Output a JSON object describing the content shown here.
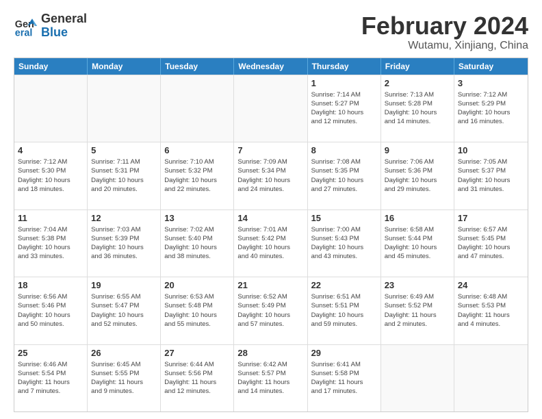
{
  "logo": {
    "text_general": "General",
    "text_blue": "Blue"
  },
  "header": {
    "title": "February 2024",
    "subtitle": "Wutamu, Xinjiang, China"
  },
  "weekdays": [
    "Sunday",
    "Monday",
    "Tuesday",
    "Wednesday",
    "Thursday",
    "Friday",
    "Saturday"
  ],
  "rows": [
    [
      {
        "day": "",
        "empty": true
      },
      {
        "day": "",
        "empty": true
      },
      {
        "day": "",
        "empty": true
      },
      {
        "day": "",
        "empty": true
      },
      {
        "day": "1",
        "info": "Sunrise: 7:14 AM\nSunset: 5:27 PM\nDaylight: 10 hours\nand 12 minutes."
      },
      {
        "day": "2",
        "info": "Sunrise: 7:13 AM\nSunset: 5:28 PM\nDaylight: 10 hours\nand 14 minutes."
      },
      {
        "day": "3",
        "info": "Sunrise: 7:12 AM\nSunset: 5:29 PM\nDaylight: 10 hours\nand 16 minutes."
      }
    ],
    [
      {
        "day": "4",
        "info": "Sunrise: 7:12 AM\nSunset: 5:30 PM\nDaylight: 10 hours\nand 18 minutes."
      },
      {
        "day": "5",
        "info": "Sunrise: 7:11 AM\nSunset: 5:31 PM\nDaylight: 10 hours\nand 20 minutes."
      },
      {
        "day": "6",
        "info": "Sunrise: 7:10 AM\nSunset: 5:32 PM\nDaylight: 10 hours\nand 22 minutes."
      },
      {
        "day": "7",
        "info": "Sunrise: 7:09 AM\nSunset: 5:34 PM\nDaylight: 10 hours\nand 24 minutes."
      },
      {
        "day": "8",
        "info": "Sunrise: 7:08 AM\nSunset: 5:35 PM\nDaylight: 10 hours\nand 27 minutes."
      },
      {
        "day": "9",
        "info": "Sunrise: 7:06 AM\nSunset: 5:36 PM\nDaylight: 10 hours\nand 29 minutes."
      },
      {
        "day": "10",
        "info": "Sunrise: 7:05 AM\nSunset: 5:37 PM\nDaylight: 10 hours\nand 31 minutes."
      }
    ],
    [
      {
        "day": "11",
        "info": "Sunrise: 7:04 AM\nSunset: 5:38 PM\nDaylight: 10 hours\nand 33 minutes."
      },
      {
        "day": "12",
        "info": "Sunrise: 7:03 AM\nSunset: 5:39 PM\nDaylight: 10 hours\nand 36 minutes."
      },
      {
        "day": "13",
        "info": "Sunrise: 7:02 AM\nSunset: 5:40 PM\nDaylight: 10 hours\nand 38 minutes."
      },
      {
        "day": "14",
        "info": "Sunrise: 7:01 AM\nSunset: 5:42 PM\nDaylight: 10 hours\nand 40 minutes."
      },
      {
        "day": "15",
        "info": "Sunrise: 7:00 AM\nSunset: 5:43 PM\nDaylight: 10 hours\nand 43 minutes."
      },
      {
        "day": "16",
        "info": "Sunrise: 6:58 AM\nSunset: 5:44 PM\nDaylight: 10 hours\nand 45 minutes."
      },
      {
        "day": "17",
        "info": "Sunrise: 6:57 AM\nSunset: 5:45 PM\nDaylight: 10 hours\nand 47 minutes."
      }
    ],
    [
      {
        "day": "18",
        "info": "Sunrise: 6:56 AM\nSunset: 5:46 PM\nDaylight: 10 hours\nand 50 minutes."
      },
      {
        "day": "19",
        "info": "Sunrise: 6:55 AM\nSunset: 5:47 PM\nDaylight: 10 hours\nand 52 minutes."
      },
      {
        "day": "20",
        "info": "Sunrise: 6:53 AM\nSunset: 5:48 PM\nDaylight: 10 hours\nand 55 minutes."
      },
      {
        "day": "21",
        "info": "Sunrise: 6:52 AM\nSunset: 5:49 PM\nDaylight: 10 hours\nand 57 minutes."
      },
      {
        "day": "22",
        "info": "Sunrise: 6:51 AM\nSunset: 5:51 PM\nDaylight: 10 hours\nand 59 minutes."
      },
      {
        "day": "23",
        "info": "Sunrise: 6:49 AM\nSunset: 5:52 PM\nDaylight: 11 hours\nand 2 minutes."
      },
      {
        "day": "24",
        "info": "Sunrise: 6:48 AM\nSunset: 5:53 PM\nDaylight: 11 hours\nand 4 minutes."
      }
    ],
    [
      {
        "day": "25",
        "info": "Sunrise: 6:46 AM\nSunset: 5:54 PM\nDaylight: 11 hours\nand 7 minutes."
      },
      {
        "day": "26",
        "info": "Sunrise: 6:45 AM\nSunset: 5:55 PM\nDaylight: 11 hours\nand 9 minutes."
      },
      {
        "day": "27",
        "info": "Sunrise: 6:44 AM\nSunset: 5:56 PM\nDaylight: 11 hours\nand 12 minutes."
      },
      {
        "day": "28",
        "info": "Sunrise: 6:42 AM\nSunset: 5:57 PM\nDaylight: 11 hours\nand 14 minutes."
      },
      {
        "day": "29",
        "info": "Sunrise: 6:41 AM\nSunset: 5:58 PM\nDaylight: 11 hours\nand 17 minutes."
      },
      {
        "day": "",
        "empty": true
      },
      {
        "day": "",
        "empty": true
      }
    ]
  ]
}
